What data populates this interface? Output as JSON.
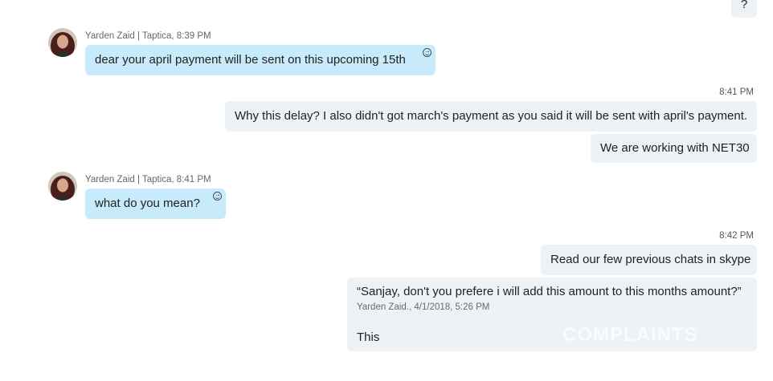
{
  "top_fragment": {
    "text": "?"
  },
  "messages": [
    {
      "sender_line": "Yarden Zaid | Taptica, 8:39 PM",
      "text": "dear your april payment will be sent on this upcoming 15th"
    },
    {
      "time": "8:41 PM",
      "texts": [
        "Why this delay? I also didn't got march's payment as you said it will be sent with april's payment.",
        "We are working with NET30"
      ]
    },
    {
      "sender_line": "Yarden Zaid | Taptica, 8:41 PM",
      "text": "what do you mean?"
    },
    {
      "time": "8:42 PM",
      "text": "Read our few previous chats in skype",
      "quote": {
        "text": "“Sanjay, don't you prefere i will add this amount to this months amount?”",
        "meta": "Yarden Zaid., 4/1/2018, 5:26 PM"
      },
      "reply": "This"
    }
  ],
  "watermark": "COMPLAINTS",
  "icons": {
    "avatar": "user-avatar",
    "reaction": "smiley-icon"
  },
  "colors": {
    "incoming_bubble": "#c7ebfa",
    "outgoing_bubble": "#edf2f6",
    "meta_text": "#666666"
  }
}
